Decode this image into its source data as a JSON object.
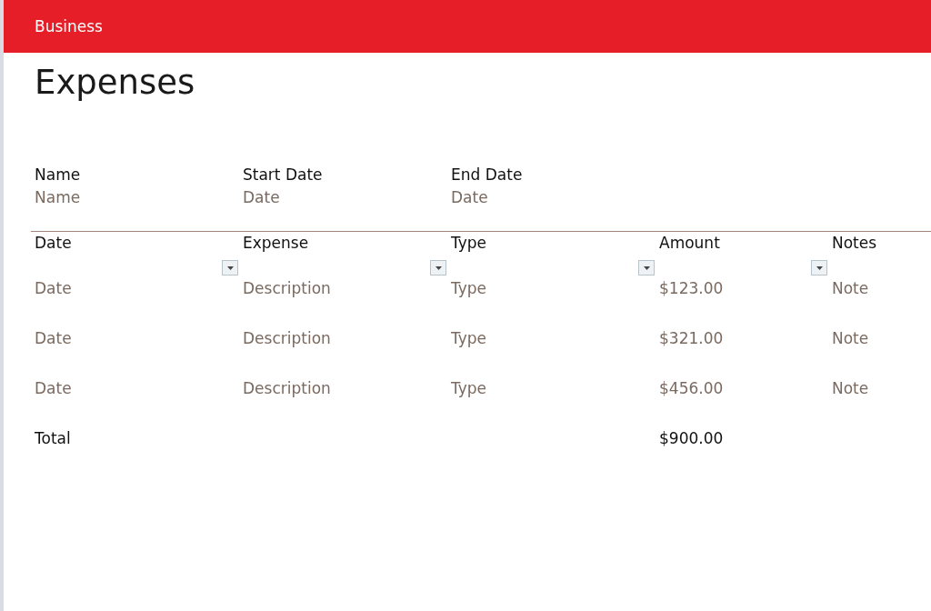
{
  "header": {
    "title": "Business"
  },
  "page_title": "Expenses",
  "parameters": [
    {
      "label": "Name",
      "value": "Name"
    },
    {
      "label": "Start Date",
      "value": "Date"
    },
    {
      "label": "End Date",
      "value": "Date"
    }
  ],
  "table": {
    "columns": [
      {
        "label": "Date",
        "filter": true
      },
      {
        "label": "Expense",
        "filter": true
      },
      {
        "label": "Type",
        "filter": true
      },
      {
        "label": "Amount",
        "filter": true
      },
      {
        "label": "Notes",
        "filter": false
      }
    ],
    "rows": [
      [
        "Date",
        "Description",
        "Type",
        "$123.00",
        "Note"
      ],
      [
        "Date",
        "Description",
        "Type",
        "$321.00",
        "Note"
      ],
      [
        "Date",
        "Description",
        "Type",
        "$456.00",
        "Note"
      ]
    ],
    "total": {
      "label": "Total",
      "amount": "$900.00"
    }
  }
}
